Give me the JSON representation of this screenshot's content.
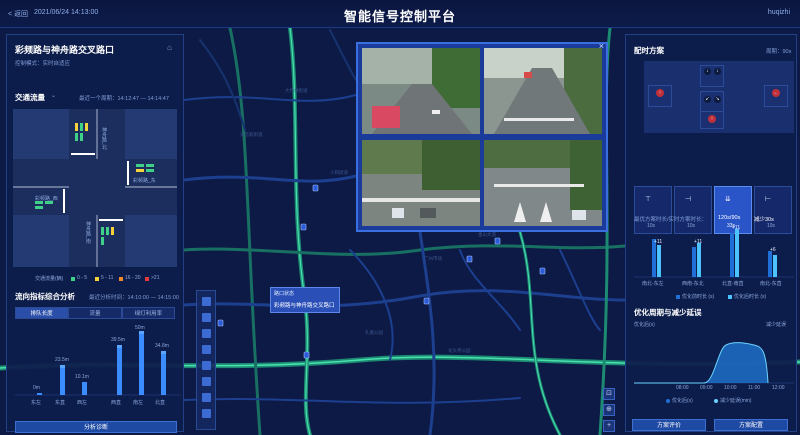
{
  "header": {
    "back": "< 返回",
    "datetime": "2021/06/24 14:13:00",
    "title": "智能信号控制平台",
    "user": "huqizhi"
  },
  "left_panel": {
    "intersection_name": "彩频路与神舟路交叉路口",
    "control_mode": "控制模式：实时自适应",
    "traffic_flow_title": "交通流量",
    "traffic_flow_period": "最近一个周期：14:12:47 — 14:14:47",
    "road_labels": {
      "north": "神舟路_北",
      "east": "彩频路_东",
      "west": "彩频路_西",
      "south": "神舟路_南"
    },
    "legend": {
      "title": "交通流量(辆)",
      "l1": "0 - 5",
      "l2": "5 - 11",
      "l3": "16 - 20",
      "l4": ">21"
    },
    "analysis_title": "流向指标综合分析",
    "analysis_period": "最近分析时间：14:10:00 — 14:15:00",
    "tabs": [
      "排队长度",
      "流量",
      "绿灯利用率"
    ],
    "chart": {
      "values": [
        "0m",
        "23.5m",
        "10.1m",
        "39.5m",
        "50m",
        "34.8m"
      ],
      "categories": [
        "东左",
        "东直",
        "西左",
        "西直",
        "南左",
        "北直"
      ]
    },
    "button": "分析诊断"
  },
  "right_panel": {
    "title": "配时方案",
    "cycle": "周期：90s",
    "phase_times": [
      "10s",
      "10s",
      "33s",
      "19s"
    ],
    "optimize_title": "最优方案时长/实时方案时长：",
    "optimize_value": "120s/90s",
    "reduce_label": "减少30s",
    "bar_labels": [
      "+11",
      "+11",
      "+11",
      "+6"
    ],
    "bar_categories": [
      "南北-东左",
      "西南-东北",
      "北直-南直",
      "南北-东直"
    ],
    "legend_a": "优化前时长 (s)",
    "legend_b": "优化后时长 (s)",
    "delay_title": "优化周期与减少延误",
    "delay_ylabel_left": "优化后(s)",
    "delay_ylabel_right": "减少延误",
    "delay_times": [
      "08:00",
      "09:00",
      "10:00",
      "11:00",
      "12:00"
    ],
    "delay_legend_a": "优化后(s)",
    "delay_legend_b": "减少延误(min)",
    "btn_eval": "方案评价",
    "btn_config": "方案配置"
  },
  "map": {
    "popup_line1": "路口状态",
    "popup_line2": "彩频路与神舟路交叉路口",
    "labels": [
      "大竹林街道",
      "人和街道",
      "天宫殿街道",
      "金山大道",
      "礼嘉公园",
      "龙头寺公园",
      "广州市场"
    ]
  },
  "colors": {
    "accent": "#3a6fe0",
    "road": "#1d7a6a",
    "road_glow": "#3ad0a8",
    "bar": "#29a7ff"
  }
}
